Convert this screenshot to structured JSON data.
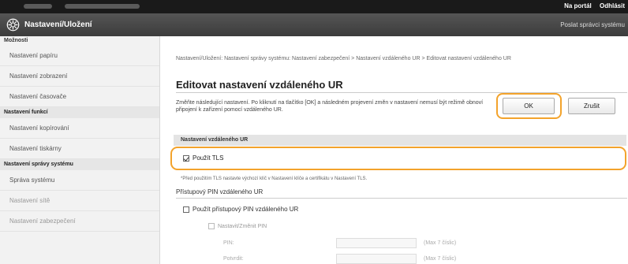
{
  "topbar": {
    "portal_link": "Na portál",
    "logout_link": "Odhlásit"
  },
  "header": {
    "title": "Nastavení/Uložení",
    "send_admin_link": "Poslat správci systému"
  },
  "sidebar": {
    "options_heading": "Možnosti",
    "items_top": [
      "Nastavení papíru",
      "Nastavení zobrazení",
      "Nastavení časovače"
    ],
    "functions_heading": "Nastavení funkcí",
    "items_functions": [
      "Nastavení kopírování",
      "Nastavení tiskárny"
    ],
    "system_heading": "Nastavení správy systému",
    "items_system": [
      "Správa systému",
      "Nastavení sítě",
      "Nastavení zabezpečení"
    ]
  },
  "main": {
    "breadcrumb": "Nastavení/Uložení: Nastavení správy systému: Nastavení zabezpečení > Nastavení vzdáleného UR > Editovat nastavení vzdáleného UR",
    "page_title": "Editovat nastavení vzdáleného UR",
    "description": "Změňte následující nastavení. Po kliknutí na tlačítko [OK] a následném projevení změn v nastavení nemusí být režimě obnoví připojení k zařízení pomocí vzdáleného UR.",
    "ok_label": "OK",
    "cancel_label": "Zrušit",
    "section_title": "Nastavení vzdáleného UR",
    "use_tls_label": "Použít TLS",
    "use_tls_checked": true,
    "tls_note": "*Před použitím TLS nastavte výchozí klíč v Nastavení klíče a certifikátu v Nastavení TLS.",
    "pin_section_title": "Přístupový PIN vzdáleného UR",
    "use_pin_label": "Použít přístupový PIN vzdáleného UR",
    "set_pin_label": "Nastavit/Změnit PIN",
    "pin_label": "PIN:",
    "confirm_label": "Potvrdit:",
    "pin_hint": "(Max 7 číslic)",
    "confirm_hint": "(Max 7 číslic)"
  },
  "colors": {
    "highlight": "#f3a32c",
    "header_bg": "#444444",
    "topbar_bg": "#1a1a1a"
  }
}
